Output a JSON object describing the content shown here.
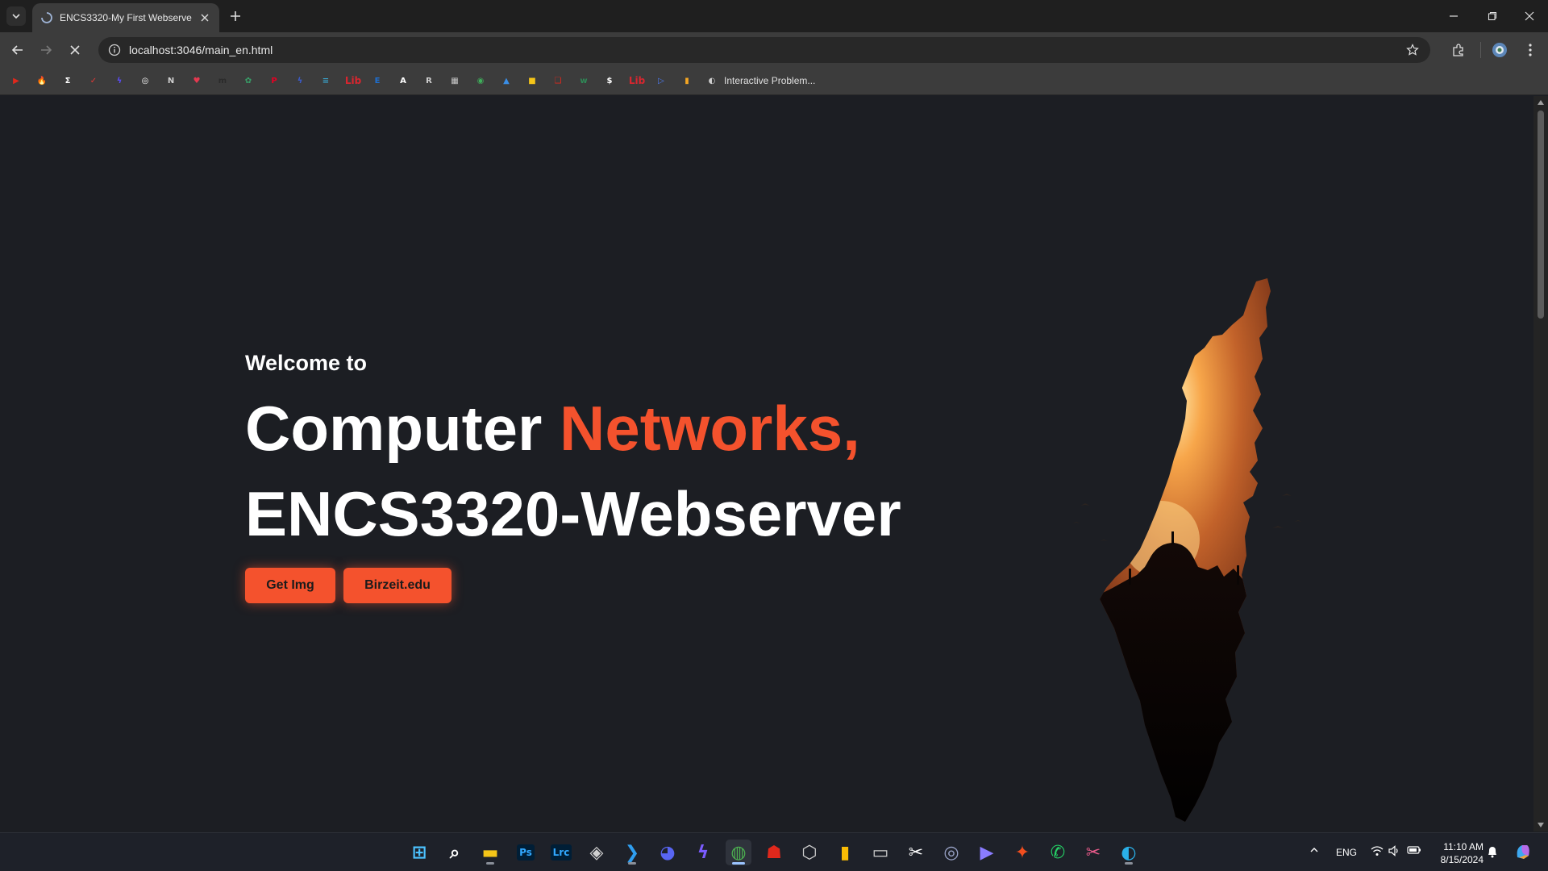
{
  "browser": {
    "tab_title": "ENCS3320-My First Webserver",
    "url": "localhost:3046/main_en.html"
  },
  "bookmarks": {
    "items": [
      {
        "icon": "youtube-icon",
        "glyph": "▶",
        "color": "#e0281c"
      },
      {
        "icon": "fire-icon",
        "glyph": "🔥",
        "color": "#f08a1a"
      },
      {
        "icon": "sigma-icon",
        "glyph": "Σ",
        "color": "#ffffff"
      },
      {
        "icon": "checkmark-icon",
        "glyph": "✓",
        "color": "#e53935"
      },
      {
        "icon": "bolt-icon",
        "glyph": "ϟ",
        "color": "#5b4cf5"
      },
      {
        "icon": "openai-icon",
        "glyph": "◎",
        "color": "#ffffff"
      },
      {
        "icon": "notion-icon",
        "glyph": "N",
        "color": "#cfcfcf"
      },
      {
        "icon": "heart-icon",
        "glyph": "♥",
        "color": "#e53950"
      },
      {
        "icon": "medium-icon",
        "glyph": "m",
        "color": "#2b2b2b"
      },
      {
        "icon": "puzzle-icon",
        "glyph": "✿",
        "color": "#38a169"
      },
      {
        "icon": "pinterest-icon",
        "glyph": "P",
        "color": "#e60023"
      },
      {
        "icon": "feather-icon",
        "glyph": "ϟ",
        "color": "#3b5ccf"
      },
      {
        "icon": "lines-icon",
        "glyph": "≡",
        "color": "#3aa0c8"
      },
      {
        "icon": "lib-icon",
        "glyph": "Lib",
        "color": "#d8262f"
      },
      {
        "icon": "e-icon",
        "glyph": "E",
        "color": "#1e6fd0"
      },
      {
        "icon": "a-icon",
        "glyph": "A",
        "color": "#ffffff"
      },
      {
        "icon": "r-icon",
        "glyph": "R",
        "color": "#d0d0d0"
      },
      {
        "icon": "grid-icon",
        "glyph": "▦",
        "color": "#c8c8c8"
      },
      {
        "icon": "globe-green-icon",
        "glyph": "◉",
        "color": "#3fae5a"
      },
      {
        "icon": "triangle-icon",
        "glyph": "▲",
        "color": "#3a8ee6"
      },
      {
        "icon": "note-icon",
        "glyph": "■",
        "color": "#f5c518"
      },
      {
        "icon": "chat-icon",
        "glyph": "❑",
        "color": "#e0281c"
      },
      {
        "icon": "w-icon",
        "glyph": "w",
        "color": "#2e8b57"
      },
      {
        "icon": "dollar-icon",
        "glyph": "$",
        "color": "#ffffff"
      },
      {
        "icon": "lib2-icon",
        "glyph": "Lib",
        "color": "#d8262f"
      },
      {
        "icon": "play-icon",
        "glyph": "▷",
        "color": "#4d7cf4"
      },
      {
        "icon": "bars-icon",
        "glyph": "▮",
        "color": "#f5a623"
      },
      {
        "icon": "interactive-problems-icon",
        "glyph": "◐",
        "color": "#cfcfcf"
      }
    ],
    "last_label": "Interactive Problem..."
  },
  "hero": {
    "welcome": "Welcome to",
    "line1_prefix": "Computer ",
    "line1_accent": "Networks,",
    "line2": "ENCS3320-Webserver",
    "btn_img": "Get Img",
    "btn_bzu": "Birzeit.edu"
  },
  "colors": {
    "accent": "#f4522d",
    "background": "#1c1e23",
    "text": "#ffffff"
  },
  "taskbar": {
    "apps": [
      {
        "name": "start-icon"
      },
      {
        "name": "search-icon"
      },
      {
        "name": "file-explorer-icon"
      },
      {
        "name": "photoshop-icon",
        "label": "Ps"
      },
      {
        "name": "lightroom-icon",
        "label": "Lrc"
      },
      {
        "name": "davinci-icon"
      },
      {
        "name": "vscode-icon"
      },
      {
        "name": "discord-icon"
      },
      {
        "name": "messenger-icon"
      },
      {
        "name": "chrome-icon"
      },
      {
        "name": "game-icon"
      },
      {
        "name": "unity-icon"
      },
      {
        "name": "keep-icon"
      },
      {
        "name": "terminal-icon"
      },
      {
        "name": "capcut-icon"
      },
      {
        "name": "disk-icon"
      },
      {
        "name": "prime-icon"
      },
      {
        "name": "figma-icon"
      },
      {
        "name": "whatsapp-icon"
      },
      {
        "name": "snipping-icon"
      },
      {
        "name": "edge-icon"
      }
    ],
    "language": "ENG",
    "time": "11:10 AM",
    "date": "8/15/2024"
  }
}
